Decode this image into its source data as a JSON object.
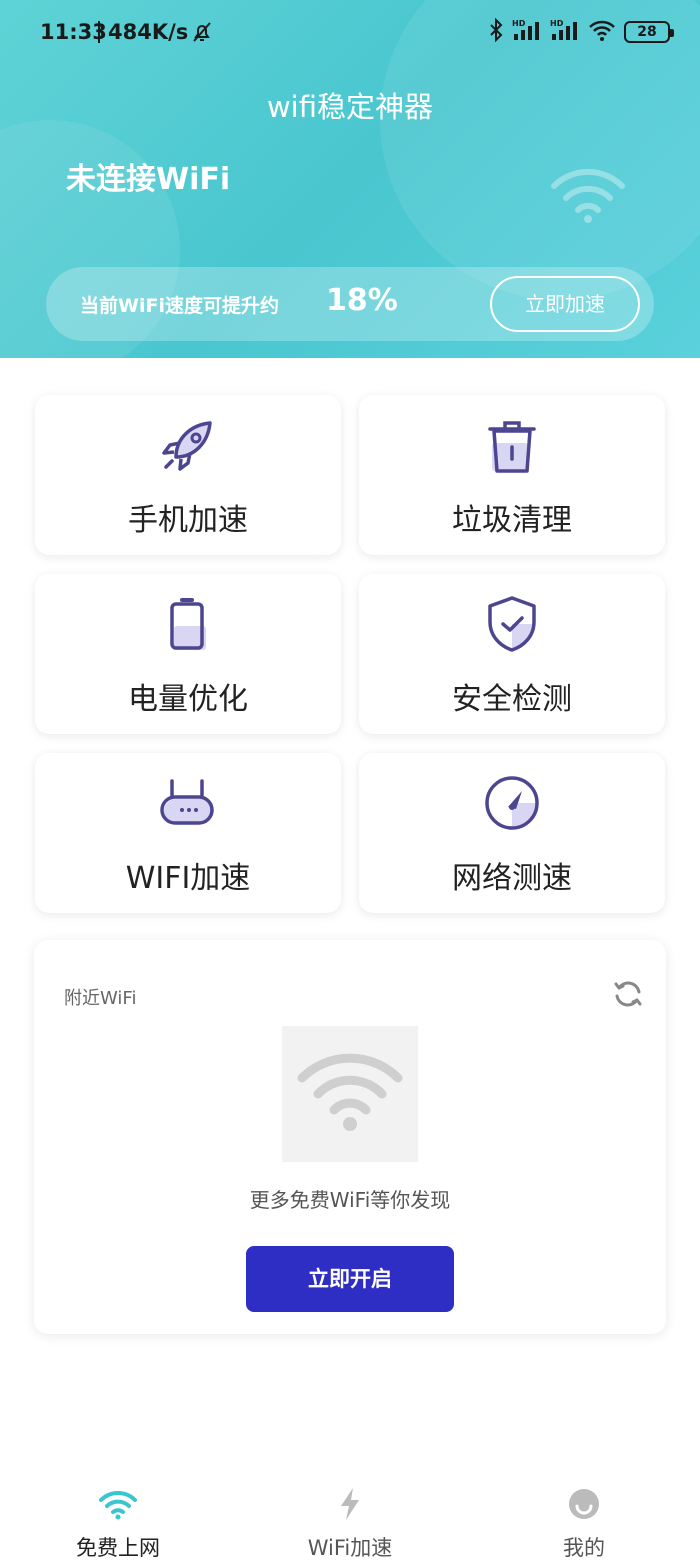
{
  "status_bar": {
    "time": "11:33",
    "speed": "484K/s",
    "battery": "28"
  },
  "header": {
    "app_title": "wifi稳定神器",
    "connection_status": "未连接WiFi",
    "speed_hint": "当前WiFi速度可提升约",
    "speed_percent": "18%",
    "boost_button": "立即加速"
  },
  "features": [
    {
      "label": "手机加速",
      "icon": "rocket-icon"
    },
    {
      "label": "垃圾清理",
      "icon": "trash-icon"
    },
    {
      "label": "电量优化",
      "icon": "battery-icon"
    },
    {
      "label": "安全检测",
      "icon": "shield-check-icon"
    },
    {
      "label": "WIFI加速",
      "icon": "router-icon"
    },
    {
      "label": "网络测速",
      "icon": "speedometer-icon"
    }
  ],
  "nearby": {
    "title": "附近WiFi",
    "empty_text": "更多免费WiFi等你发现",
    "open_button": "立即开启"
  },
  "bottom_nav": [
    {
      "label": "免费上网",
      "icon": "wifi-icon",
      "active": true
    },
    {
      "label": "WiFi加速",
      "icon": "lightning-icon",
      "active": false
    },
    {
      "label": "我的",
      "icon": "smiley-icon",
      "active": false
    }
  ],
  "colors": {
    "header_gradient": "#4fcbd3",
    "icon_purple": "#4b468f",
    "icon_accent": "#d8d6f2",
    "primary_button": "#2e2ec4",
    "nav_active": "#3ac6cf",
    "nav_inactive": "#bbbbbb"
  }
}
